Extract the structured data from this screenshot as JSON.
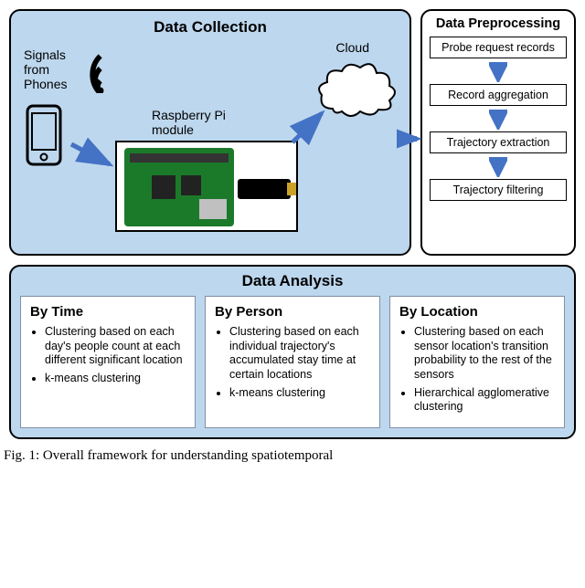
{
  "dataCollection": {
    "title": "Data Collection",
    "signalsLabel": "Signals from Phones",
    "piLabel": "Raspberry Pi module",
    "cloudLabel": "Cloud"
  },
  "dataPreproc": {
    "title": "Data Preprocessing",
    "steps": [
      "Probe request records",
      "Record aggregation",
      "Trajectory extraction",
      "Trajectory filtering"
    ]
  },
  "dataAnalysis": {
    "title": "Data Analysis",
    "cards": [
      {
        "heading": "By Time",
        "bullets": [
          "Clustering based on each day's people count at each different significant location",
          "k-means clustering"
        ]
      },
      {
        "heading": "By Person",
        "bullets": [
          "Clustering based on each individual trajectory's accumulated stay time at certain locations",
          "k-means clustering"
        ]
      },
      {
        "heading": "By Location",
        "bullets": [
          "Clustering based on each sensor location's transition probability to the rest of the sensors",
          "Hierarchical agglomerative clustering"
        ]
      }
    ]
  },
  "caption": "Fig. 1: Overall framework for understanding spatiotemporal"
}
